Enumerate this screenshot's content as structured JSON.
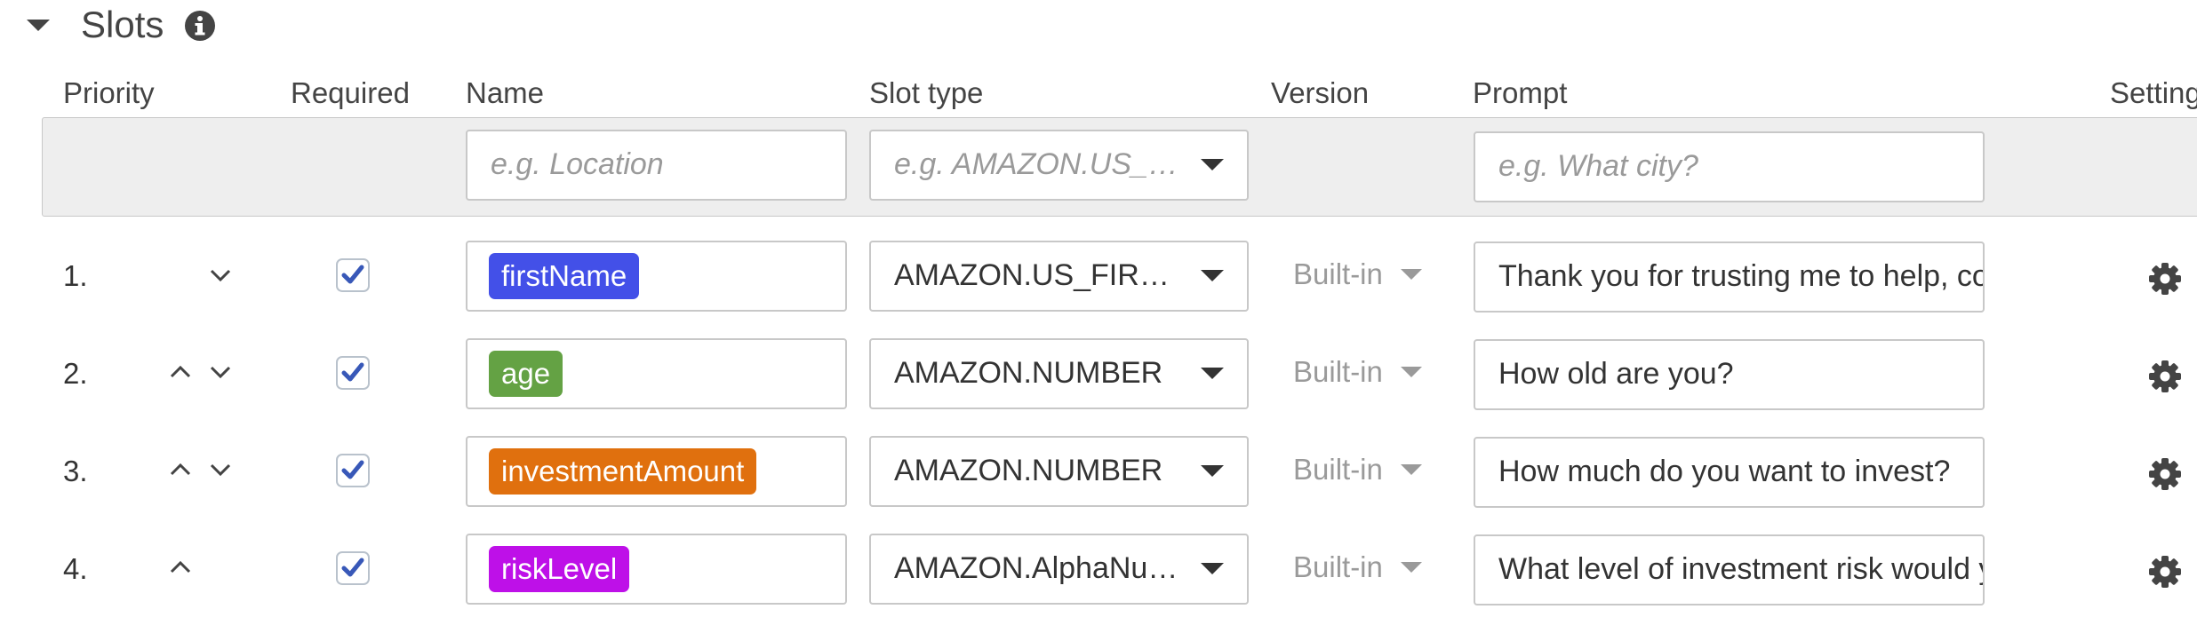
{
  "section": {
    "title": "Slots"
  },
  "columns": {
    "priority": "Priority",
    "required": "Required",
    "name": "Name",
    "slot_type": "Slot type",
    "version": "Version",
    "prompt": "Prompt",
    "settings": "Settings"
  },
  "filters": {
    "name_placeholder": "e.g. Location",
    "slot_type_placeholder": "e.g. AMAZON.US_CITY",
    "prompt_placeholder": "e.g. What city?"
  },
  "colors": {
    "firstName": "#4350e8",
    "age": "#64a244",
    "investmentAmount": "#e0700e",
    "riskLevel": "#be10e8",
    "checkbox_tick": "#3858b8"
  },
  "rows": [
    {
      "index": "1.",
      "required": true,
      "name": "firstName",
      "slot_type": "AMAZON.US_FIRST_NAME",
      "version": "Built-in",
      "prompt": "Thank you for trusting me to help, could you please give me your name?"
    },
    {
      "index": "2.",
      "required": true,
      "name": "age",
      "slot_type": "AMAZON.NUMBER",
      "version": "Built-in",
      "prompt": "How old are you?"
    },
    {
      "index": "3.",
      "required": true,
      "name": "investmentAmount",
      "slot_type": "AMAZON.NUMBER",
      "version": "Built-in",
      "prompt": "How much do you want to invest?"
    },
    {
      "index": "4.",
      "required": true,
      "name": "riskLevel",
      "slot_type": "AMAZON.AlphaNumeric",
      "version": "Built-in",
      "prompt": "What level of investment risk would you be comfortable with?"
    }
  ]
}
